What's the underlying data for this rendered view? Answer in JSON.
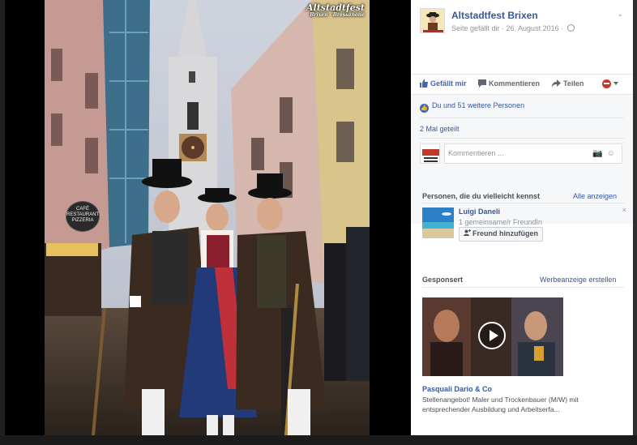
{
  "photo": {
    "watermark_title": "Altstadtfest",
    "watermark_sub": "Brixen · Bressanone",
    "cafe_sign_lines": [
      "CAFÉ",
      "RESTAURANT",
      "PIZZERIA"
    ]
  },
  "post": {
    "page_name": "Altstadtfest Brixen",
    "meta_text": "Seite gefällt dir · 26. August 2016 ·",
    "menu_icon": "chevron-down-icon"
  },
  "actions": {
    "like_label": "Gefällt mir",
    "comment_label": "Kommentieren",
    "share_label": "Teilen"
  },
  "reactions": {
    "likes_text": "Du und 51 weitere Personen",
    "shared_text": "2 Mal geteilt"
  },
  "comment_box": {
    "placeholder": "Kommentieren ..."
  },
  "people": {
    "title": "Personen, die du vielleicht kennst",
    "see_all": "Alle anzeigen",
    "suggestion": {
      "name": "Luigi Daneli",
      "mutual": "1 gemeinsame/r FreundIn",
      "add_button": "Freund hinzufügen",
      "dismiss": "×"
    }
  },
  "sponsored": {
    "title": "Gesponsert",
    "create_link": "Werbeanzeige erstellen",
    "advertiser": "Pasquali Dario & Co",
    "text": "Stellenangebot! Maler und Trockenbauer (M/W) mit entsprechender Ausbildung und Arbeitserfa..."
  },
  "colors": {
    "link": "#365899",
    "like_blue": "#4267b2",
    "muted": "#90949c"
  }
}
